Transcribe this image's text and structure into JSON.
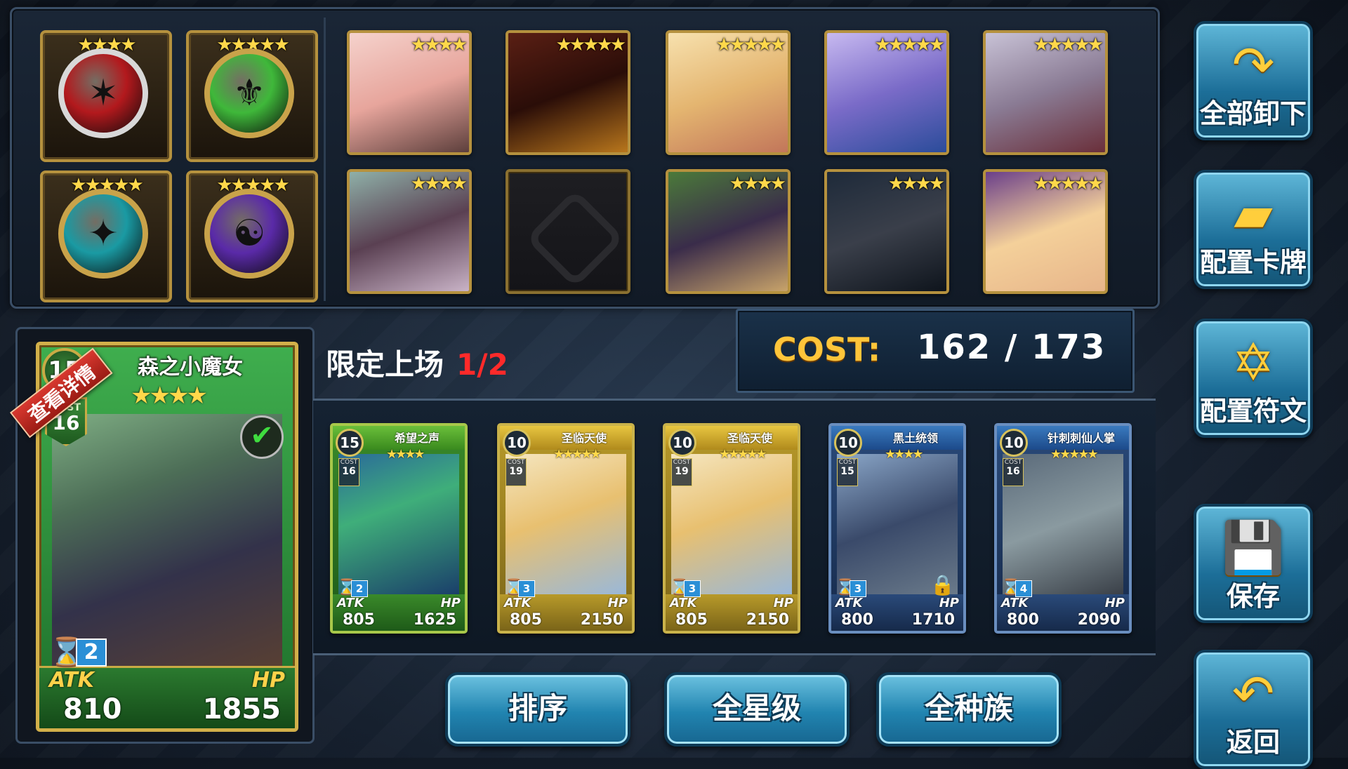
{
  "runes": [
    {
      "stars": "★★★★",
      "color": "#b3191d",
      "ring": "#d8d8d8",
      "symbol": "✶"
    },
    {
      "stars": "★★★★★",
      "color": "#3fb83a",
      "ring": "#c9a34a",
      "symbol": "⚜"
    },
    {
      "stars": "★★★★★",
      "color": "#1a9aa3",
      "ring": "#c9a34a",
      "symbol": "✦"
    },
    {
      "stars": "★★★★★",
      "color": "#5a2aa8",
      "ring": "#c9a34a",
      "symbol": "☯"
    }
  ],
  "deck_cards": [
    {
      "stars": "★★★★",
      "grad": "linear-gradient(160deg,#f5d2cc,#e7a59c 50%,#5d3f3c)"
    },
    {
      "stars": "★★★★★",
      "grad": "linear-gradient(160deg,#5a1f14,#2a0d08 50%,#b8761c)"
    },
    {
      "stars": "★★★★★",
      "grad": "linear-gradient(160deg,#f7e1ae,#e4b570 50%,#c2765a)"
    },
    {
      "stars": "★★★★★",
      "grad": "linear-gradient(160deg,#c7b9f0,#7a6bc8 50%,#2b4c9a)"
    },
    {
      "stars": "★★★★★",
      "grad": "linear-gradient(160deg,#c8c2d6,#8a7b94 50%,#6a2f3a)"
    },
    {
      "stars": "★★★★",
      "grad": "linear-gradient(160deg,#8fb0a8,#5a4052 50%,#c9b3c7)"
    },
    {
      "stars": "",
      "grad": ""
    },
    {
      "stars": "★★★★",
      "grad": "linear-gradient(160deg,#4b7a3a,#3a2c4a 50%,#c8a36a)"
    },
    {
      "stars": "★★★★",
      "grad": "linear-gradient(160deg,#1e2a3a,#3a3f4a 50%,#0e141c)"
    },
    {
      "stars": "★★★★★",
      "grad": "linear-gradient(160deg,#6a3f8a,#f4d09a 50%,#e7b58a)"
    }
  ],
  "side_buttons": [
    {
      "label": "全部卸下",
      "icon": "↷"
    },
    {
      "label": "配置卡牌",
      "icon": "▰"
    },
    {
      "label": "配置符文",
      "icon": "✡"
    },
    {
      "label": "保存",
      "icon": "💾"
    },
    {
      "label": "返回",
      "icon": "↶"
    }
  ],
  "featured": {
    "ribbon": "查看详情",
    "level": "15",
    "cost_label": "COST",
    "cost": "16",
    "name": "森之小魔女",
    "stars": "★★★★",
    "skill": "2",
    "atk_label": "ATK",
    "hp_label": "HP",
    "atk": "810",
    "hp": "1855"
  },
  "limit": {
    "label": "限定上场",
    "value": "1/2"
  },
  "cost": {
    "label": "COST:",
    "value": "162  /  173"
  },
  "hand": [
    {
      "name": "希望之声",
      "level": "15",
      "cost": "16",
      "stars": "★★★★",
      "skill": "2",
      "atk": "805",
      "hp": "1625",
      "frame": "green",
      "grad": "linear-gradient(160deg,#2a6a9a,#3fae7a 40%,#1a3f6a)",
      "locked": false
    },
    {
      "name": "圣临天使",
      "level": "10",
      "cost": "19",
      "stars": "★★★★★",
      "skill": "3",
      "atk": "805",
      "hp": "2150",
      "frame": "gold",
      "grad": "linear-gradient(160deg,#f5e6c0,#e8c070 45%,#9ab8d8)",
      "locked": false
    },
    {
      "name": "圣临天使",
      "level": "10",
      "cost": "19",
      "stars": "★★★★★",
      "skill": "3",
      "atk": "805",
      "hp": "2150",
      "frame": "gold",
      "grad": "linear-gradient(160deg,#f5e6c0,#e8c070 45%,#9ab8d8)",
      "locked": false
    },
    {
      "name": "黑土统领",
      "level": "10",
      "cost": "15",
      "stars": "★★★★",
      "skill": "3",
      "atk": "800",
      "hp": "1710",
      "frame": "blue",
      "grad": "linear-gradient(160deg,#8aa6c8,#3a4a6a 50%,#6a7a8a)",
      "locked": true
    },
    {
      "name": "针刺刺仙人掌",
      "level": "10",
      "cost": "16",
      "stars": "★★★★★",
      "skill": "4",
      "atk": "800",
      "hp": "2090",
      "frame": "blue",
      "grad": "linear-gradient(160deg,#5a6a7a,#8a9aa0 50%,#3a4048)",
      "locked": false
    }
  ],
  "hand_labels": {
    "cost": "COST",
    "atk": "ATK",
    "hp": "HP"
  },
  "bottom_buttons": [
    "排序",
    "全星级",
    "全种族"
  ]
}
